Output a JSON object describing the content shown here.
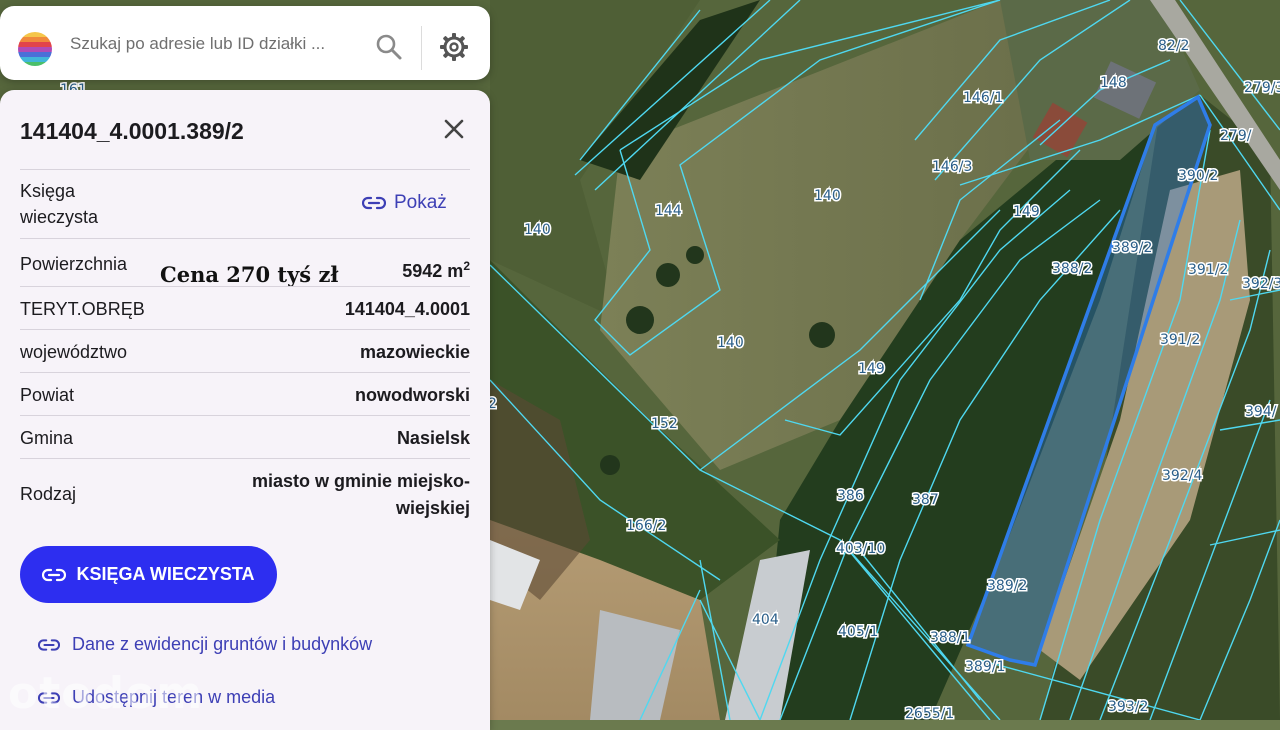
{
  "search": {
    "placeholder": "Szukaj po adresie lub ID działki ..."
  },
  "icons": {
    "logo": "rainbow-globe-logo",
    "search": "search-icon",
    "settings": "gear-icon",
    "close": "close-icon",
    "link": "link-icon"
  },
  "colors": {
    "primary": "#2d2ef0",
    "link": "#3d3fb5",
    "parcel_line": "#4fd8f0",
    "selected_parcel": "#2f7de8"
  },
  "panel": {
    "title": "141404_4.0001.389/2",
    "price_overlay": "Cena 270 tyś zł",
    "rows": [
      {
        "label": "Księga wieczysta",
        "action": "Pokaż"
      },
      {
        "label": "Powierzchnia",
        "value": "5942 m",
        "value_sup": "2"
      },
      {
        "label": "TERYT.OBRĘB",
        "value": "141404_4.0001"
      },
      {
        "label": "województwo",
        "value": "mazowieckie"
      },
      {
        "label": "Powiat",
        "value": "nowodworski"
      },
      {
        "label": "Gmina",
        "value": "Nasielsk"
      },
      {
        "label": "Rodzaj",
        "value_line1": "miasto w gminie miejsko-",
        "value_line2": "wiejskiej"
      }
    ],
    "primary_button": "KSIĘGA WIECZYSTA",
    "link1": "Dane z ewidencji gruntów i budynków",
    "link2": "Udostępnij teren w media"
  },
  "watermark": "otodom",
  "map_labels": [
    "161",
    "140",
    "144",
    "140",
    "140",
    "146/1",
    "146/3",
    "148",
    "82/2",
    "279/3",
    "279/",
    "390/2",
    "149",
    "388/2",
    "389/2",
    "391/2",
    "392/3",
    "391/2",
    "149",
    "152",
    "2",
    "394/",
    "392/4",
    "386",
    "387",
    "166/2",
    "403/10",
    "389/2",
    "404",
    "405/1",
    "388/1",
    "389/1",
    "393/2",
    "2655/1"
  ]
}
